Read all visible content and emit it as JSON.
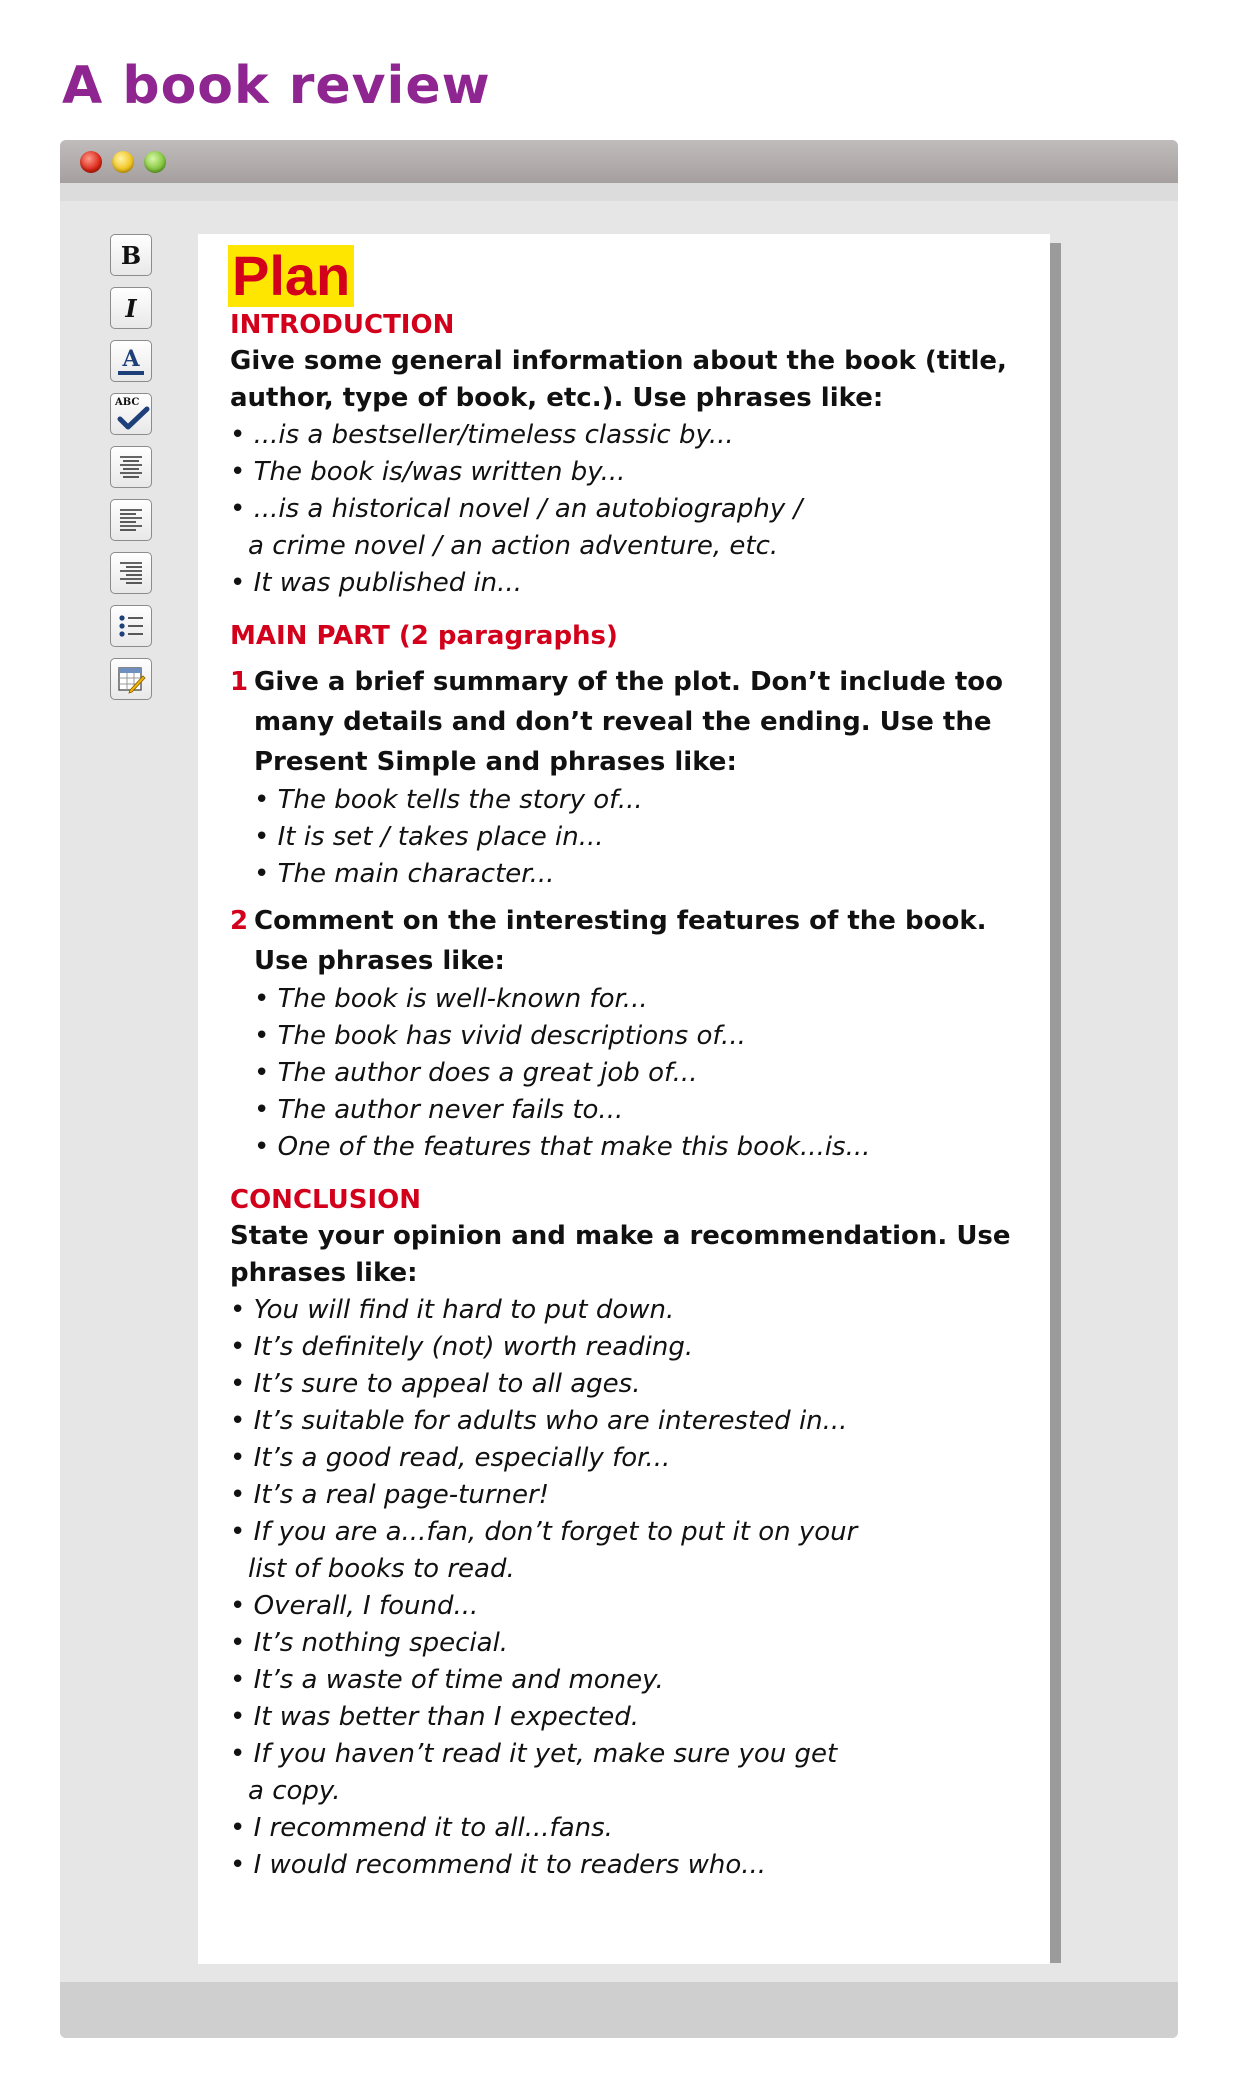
{
  "page_title": "A book review",
  "toolbar": {
    "bold_label": "B",
    "italic_label": "I",
    "font_color_label": "A",
    "spellcheck_label": "ABC"
  },
  "document": {
    "title": "Plan",
    "introduction": {
      "heading": "INTRODUCTION",
      "instruction": "Give some general information about the book (title, author, type of book, etc.). Use phrases like:",
      "phrases": [
        "• ...is a bestseller/timeless classic by...",
        "• The book is/was written by...",
        "• ...is a historical novel / an autobiography /",
        "a crime novel / an action adventure, etc.",
        "• It was published in..."
      ]
    },
    "main_part": {
      "heading": "MAIN PART (2 paragraphs)",
      "items": [
        {
          "number": "1",
          "instruction": "Give a brief summary of the plot. Don’t include too many details and don’t reveal the ending. Use the Present Simple and phrases like:",
          "phrases": [
            "• The book tells the story of...",
            "• It is set / takes place in...",
            "• The main character..."
          ]
        },
        {
          "number": "2",
          "instruction": "Comment on the interesting features of the book. Use phrases like:",
          "phrases": [
            "• The book is well-known for...",
            "• The book has vivid descriptions of...",
            "• The author does a great job of...",
            "• The author never fails to...",
            "• One of the features that make this book...is..."
          ]
        }
      ]
    },
    "conclusion": {
      "heading": "CONCLUSION",
      "instruction": "State your opinion and make a recommendation. Use phrases like:",
      "phrases": [
        "• You will find it hard to put down.",
        "• It’s definitely (not) worth reading.",
        "• It’s sure to appeal to all ages.",
        "• It’s suitable for adults who are interested in...",
        "• It’s a good read, especially for...",
        "• It’s a real page-turner!",
        "• If you are a...fan, don’t forget to put it on your",
        "list of books to read.",
        "• Overall, I found...",
        "• It’s nothing special.",
        "• It’s a waste of time and money.",
        "• It was better than I expected.",
        "• If you haven’t read it yet, make sure you get",
        "a copy.",
        "• I recommend it to all...fans.",
        "• I would recommend it to readers who..."
      ]
    }
  },
  "colors": {
    "heading_purple": "#8e2590",
    "accent_red": "#d3001c",
    "highlight_yellow": "#ffe600"
  }
}
